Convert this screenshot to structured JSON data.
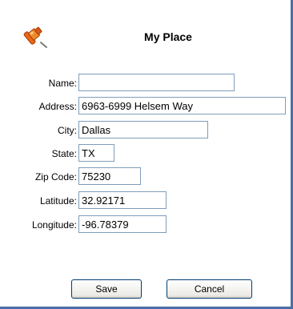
{
  "dialog": {
    "title": "My Place"
  },
  "fields": [
    {
      "label": "Name:",
      "value": ""
    },
    {
      "label": "Address:",
      "value": "6963-6999 Helsem Way"
    },
    {
      "label": "City:",
      "value": "Dallas"
    },
    {
      "label": "State:",
      "value": "TX"
    },
    {
      "label": "Zip Code:",
      "value": "75230"
    },
    {
      "label": "Latitude:",
      "value": "32.92171"
    },
    {
      "label": "Longitude:",
      "value": "-96.78379"
    }
  ],
  "buttons": {
    "save_label": "Save",
    "cancel_label": "Cancel"
  },
  "icons": {
    "header_icon": "pushpin-icon"
  }
}
